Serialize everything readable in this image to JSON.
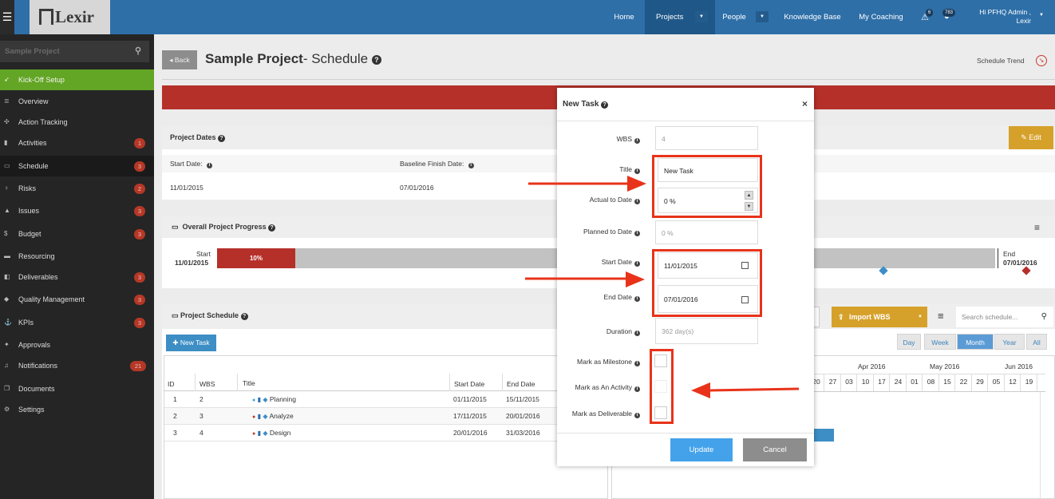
{
  "app": {
    "logo_text": "Lexir",
    "menu_icon": "hamburger-icon"
  },
  "topnav": {
    "items": [
      "Home",
      "Projects",
      "People",
      "Knowledge Base",
      "My Coaching"
    ],
    "alerts_count": "6",
    "messages_count": "783",
    "user_line1": "Hi PFHQ Admin ,",
    "user_line2": "Lexir"
  },
  "sidebar": {
    "search_placeholder": "Sample Project",
    "items": [
      {
        "label": "Kick-Off Setup",
        "icon": "rocket-icon",
        "badge": ""
      },
      {
        "label": "Overview",
        "icon": "list-icon",
        "badge": ""
      },
      {
        "label": "Action Tracking",
        "icon": "crosshair-icon",
        "badge": ""
      },
      {
        "label": "Activities",
        "icon": "bookmark-icon",
        "badge": "1"
      },
      {
        "label": "Schedule",
        "icon": "calendar-icon",
        "badge": "3"
      },
      {
        "label": "Risks",
        "icon": "lightbulb-icon",
        "badge": "2"
      },
      {
        "label": "Issues",
        "icon": "warning-icon",
        "badge": "3"
      },
      {
        "label": "Budget",
        "icon": "dollar-icon",
        "badge": "3"
      },
      {
        "label": "Resourcing",
        "icon": "folder-icon",
        "badge": ""
      },
      {
        "label": "Deliverables",
        "icon": "chart-icon",
        "badge": "3"
      },
      {
        "label": "Quality Management",
        "icon": "tag-icon",
        "badge": "3"
      },
      {
        "label": "KPIs",
        "icon": "anchor-icon",
        "badge": "3"
      },
      {
        "label": "Approvals",
        "icon": "thumbs-up-icon",
        "badge": ""
      },
      {
        "label": "Notifications",
        "icon": "bell-icon",
        "badge": "21"
      },
      {
        "label": "Documents",
        "icon": "documents-icon",
        "badge": ""
      },
      {
        "label": "Settings",
        "icon": "gears-icon",
        "badge": ""
      }
    ]
  },
  "page": {
    "back_label": "Back",
    "title": "Sample Project",
    "subtitle": "- Schedule",
    "schedule_trend": "Schedule Trend"
  },
  "project_dates": {
    "heading": "Project Dates",
    "edit_label": "Edit",
    "start_label": "Start Date:",
    "start_value": "11/01/2015",
    "baseline_label": "Baseline Finish Date:",
    "baseline_value": "07/01/2016"
  },
  "progress": {
    "heading": "Overall Project Progress",
    "start_label": "Start",
    "start_date": "11/01/2015",
    "end_label": "End",
    "end_date": "07/01/2016",
    "percent_label": "10%",
    "fraction": 0.1
  },
  "schedule": {
    "heading": "Project Schedule",
    "new_task_label": "New Task",
    "import_label": "Import WBS",
    "search_placeholder": "Search schedule...",
    "views": [
      "Day",
      "Week",
      "Month",
      "Year",
      "All"
    ],
    "active_view": "Month",
    "columns": [
      "ID",
      "WBS",
      "Title",
      "Start Date",
      "End Date"
    ],
    "rows": [
      {
        "id": "1",
        "wbs": "2",
        "title": "Planning",
        "start": "01/11/2015",
        "end": "15/11/2015",
        "dot": "#3ea0d8"
      },
      {
        "id": "2",
        "wbs": "3",
        "title": "Analyze",
        "start": "17/11/2015",
        "end": "20/01/2016",
        "dot": "#c0392b"
      },
      {
        "id": "3",
        "wbs": "4",
        "title": "Design",
        "start": "20/01/2016",
        "end": "31/03/2016",
        "dot": "#c0392b"
      }
    ],
    "gantt_months": [
      "Apr 2016",
      "May 2016",
      "Jun 2016"
    ],
    "gantt_days": [
      "20",
      "27",
      "03",
      "10",
      "17",
      "24",
      "01",
      "08",
      "15",
      "22",
      "29",
      "05",
      "12",
      "19"
    ]
  },
  "modal": {
    "title": "New Task",
    "close": "×",
    "fields": {
      "wbs_label": "WBS",
      "wbs_value": "4",
      "title_label": "Title",
      "title_value": "New Task",
      "actual_label": "Actual to Date",
      "actual_value": "0 %",
      "planned_label": "Planned to Date",
      "planned_value": "0 %",
      "start_label": "Start Date",
      "start_value": "11/01/2015",
      "end_label": "End Date",
      "end_value": "07/01/2016",
      "duration_label": "Duration",
      "duration_value": "362 day(s)",
      "milestone_label": "Mark as Milestone",
      "activity_label": "Mark as An Activity",
      "deliverable_label": "Mark as Deliverable"
    },
    "update_label": "Update",
    "cancel_label": "Cancel"
  },
  "colors": {
    "accent": "#2e6fa8",
    "danger": "#b6302a",
    "warning": "#d6a12b",
    "annotation": "#e8331a"
  }
}
